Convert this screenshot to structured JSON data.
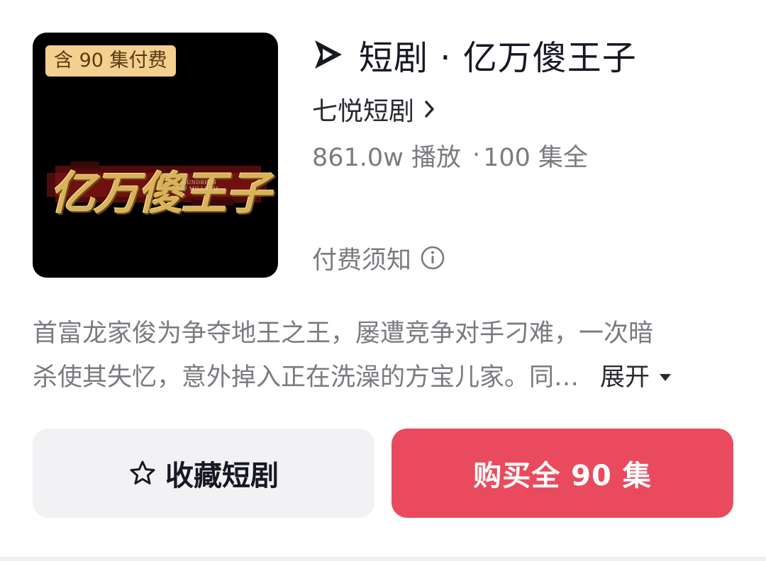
{
  "cover": {
    "badge": "含 90 集付费",
    "art_title": "亿万傻王子",
    "art_subtitle": "HUNDREDS OF MILLIONS"
  },
  "header": {
    "play_icon": "douyin-play-icon",
    "title": "短剧 · 亿万傻王子",
    "creator": "七悦短剧",
    "stats_plays": "861.0w 播放",
    "stats_episodes": "100 集全"
  },
  "notice": {
    "label": "付费须知",
    "icon": "info-circle-icon"
  },
  "description": {
    "line1": "首富龙家俊为争夺地王之王，屡遭竞争对手刁难，一次暗",
    "line2": "杀使其失忆，意外掉入正在洗澡的方宝儿家。同…",
    "expand_label": "展开"
  },
  "actions": {
    "collect_label": "收藏短剧",
    "buy_label": "购买全 90 集"
  },
  "colors": {
    "primary": "#ea4a5d",
    "badge_bg": "#f3d08f",
    "secondary_bg": "#f2f2f4",
    "text_dark": "#161823",
    "text_muted": "#7a7b80"
  }
}
